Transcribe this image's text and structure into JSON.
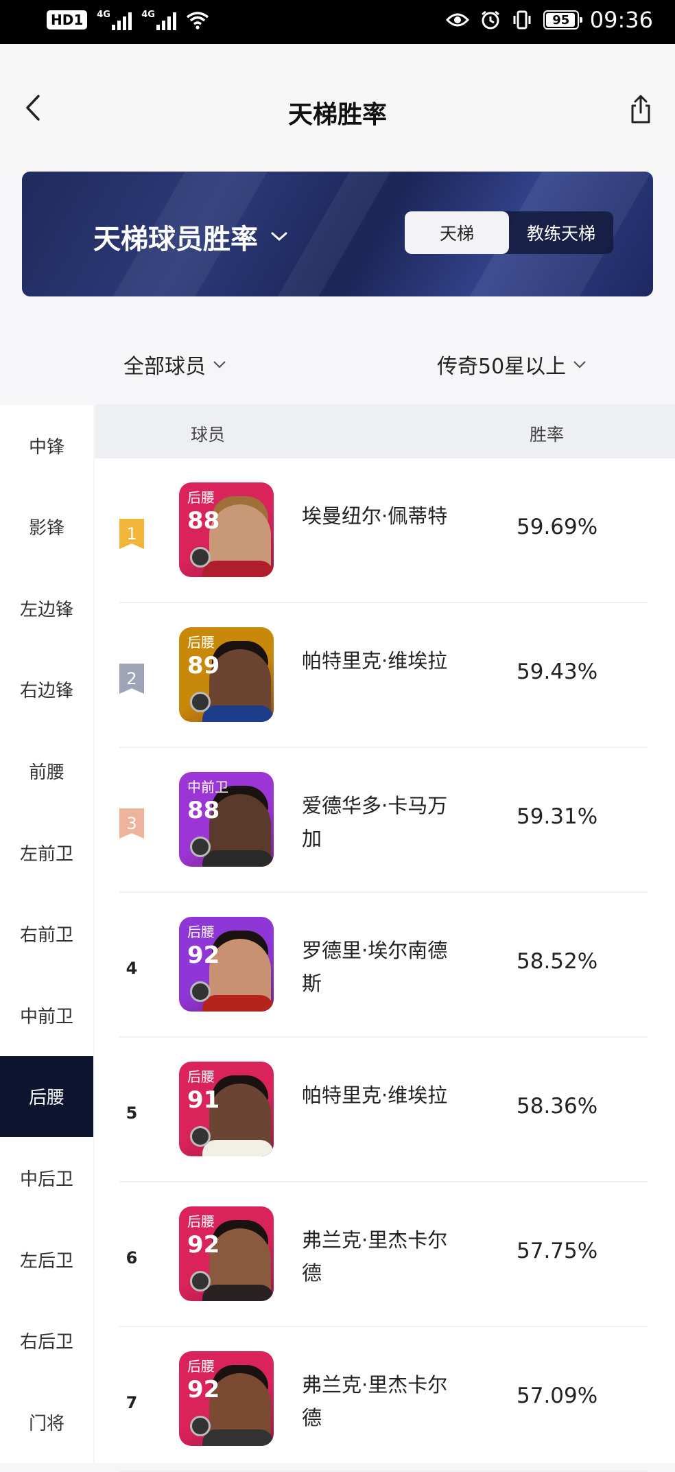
{
  "status_bar": {
    "hd_label": "HD",
    "sim_label": "1",
    "network_1": "4G",
    "network_2": "4G",
    "battery": "95",
    "battery_level": 0.95,
    "time": "09:36",
    "icons": [
      "eye-icon",
      "alarm-icon",
      "vibrate-icon"
    ]
  },
  "header": {
    "title": "天梯胜率",
    "back_icon": "chevron-left-icon",
    "share_icon": "share-icon"
  },
  "banner": {
    "title": "天梯球员胜率",
    "toggle": [
      {
        "label": "天梯",
        "active": true
      },
      {
        "label": "教练天梯",
        "active": false
      }
    ]
  },
  "filters": {
    "player_filter": "全部球员",
    "level_filter": "传奇50星以上"
  },
  "positions": [
    {
      "label": "中锋",
      "active": false
    },
    {
      "label": "影锋",
      "active": false
    },
    {
      "label": "左边锋",
      "active": false
    },
    {
      "label": "右边锋",
      "active": false
    },
    {
      "label": "前腰",
      "active": false
    },
    {
      "label": "左前卫",
      "active": false
    },
    {
      "label": "右前卫",
      "active": false
    },
    {
      "label": "中前卫",
      "active": false
    },
    {
      "label": "后腰",
      "active": true
    },
    {
      "label": "中后卫",
      "active": false
    },
    {
      "label": "左后卫",
      "active": false
    },
    {
      "label": "右后卫",
      "active": false
    },
    {
      "label": "门将",
      "active": false
    }
  ],
  "table": {
    "col_player": "球员",
    "col_winrate": "胜率",
    "rows": [
      {
        "rank": "1",
        "position": "后腰",
        "rating": "88",
        "name": "埃曼纽尔·佩蒂特",
        "winrate": "59.69%",
        "card_color": "#d9235a",
        "medal": "#f2b53a"
      },
      {
        "rank": "2",
        "position": "后腰",
        "rating": "89",
        "name": "帕特里克·维埃拉",
        "winrate": "59.43%",
        "card_color": "#c8890a",
        "medal": "#9ea3b8"
      },
      {
        "rank": "3",
        "position": "中前卫",
        "rating": "88",
        "name": "爱德华多·卡马万加",
        "winrate": "59.31%",
        "card_color": "#9c35d6",
        "medal": "#eeb39a"
      },
      {
        "rank": "4",
        "position": "后腰",
        "rating": "92",
        "name": "罗德里·埃尔南德斯",
        "winrate": "58.52%",
        "card_color": "#8f36d6",
        "medal": ""
      },
      {
        "rank": "5",
        "position": "后腰",
        "rating": "91",
        "name": "帕特里克·维埃拉",
        "winrate": "58.36%",
        "card_color": "#d9235a",
        "medal": ""
      },
      {
        "rank": "6",
        "position": "后腰",
        "rating": "92",
        "name": "弗兰克·里杰卡尔德",
        "winrate": "57.75%",
        "card_color": "#d9235a",
        "medal": ""
      },
      {
        "rank": "7",
        "position": "后腰",
        "rating": "92",
        "name": "弗兰克·里杰卡尔德",
        "winrate": "57.09%",
        "card_color": "#d9235a",
        "medal": ""
      }
    ]
  }
}
